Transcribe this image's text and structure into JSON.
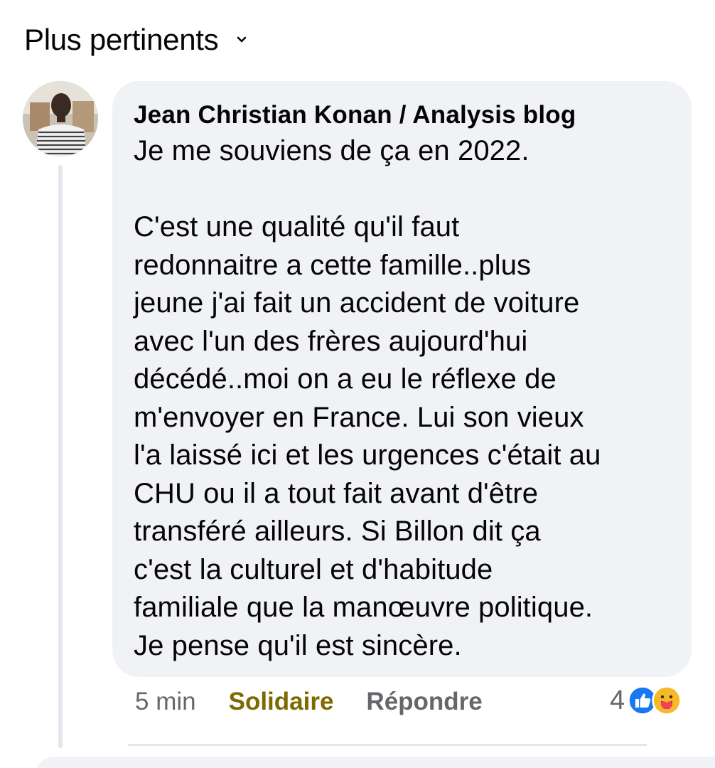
{
  "sort": {
    "label": "Plus pertinents",
    "icon": "chevron-down-icon"
  },
  "comment": {
    "author": "Jean Christian Konan / Analysis blog",
    "text": "Je me souviens de ça en 2022.\n\nC'est une qualité qu'il faut\nredonnaitre a cette famille..plus\njeune j'ai fait un accident de voiture\navec l'un des frères aujourd'hui\ndécédé..moi on a eu le réflexe de\nm'envoyer en France. Lui son vieux\nl'a laissé ici et les urgences c'était au\nCHU ou il a tout fait avant d'être\ntransféré ailleurs.  Si Billon dit ça\nc'est la culturel et d'habitude\nfamiliale que la manœuvre politique.\nJe pense qu'il est sincère.",
    "time": "5 min",
    "reaction_label": "Solidaire",
    "reply_label": "Répondre",
    "reaction_count": "4",
    "reaction_icons": [
      "like-icon",
      "care-icon"
    ],
    "colors": {
      "bubble": "#f0f2f5",
      "solidaire": "#7d6a00",
      "like_blue": "#1877f2",
      "care_yellow": "#f7b928"
    }
  }
}
